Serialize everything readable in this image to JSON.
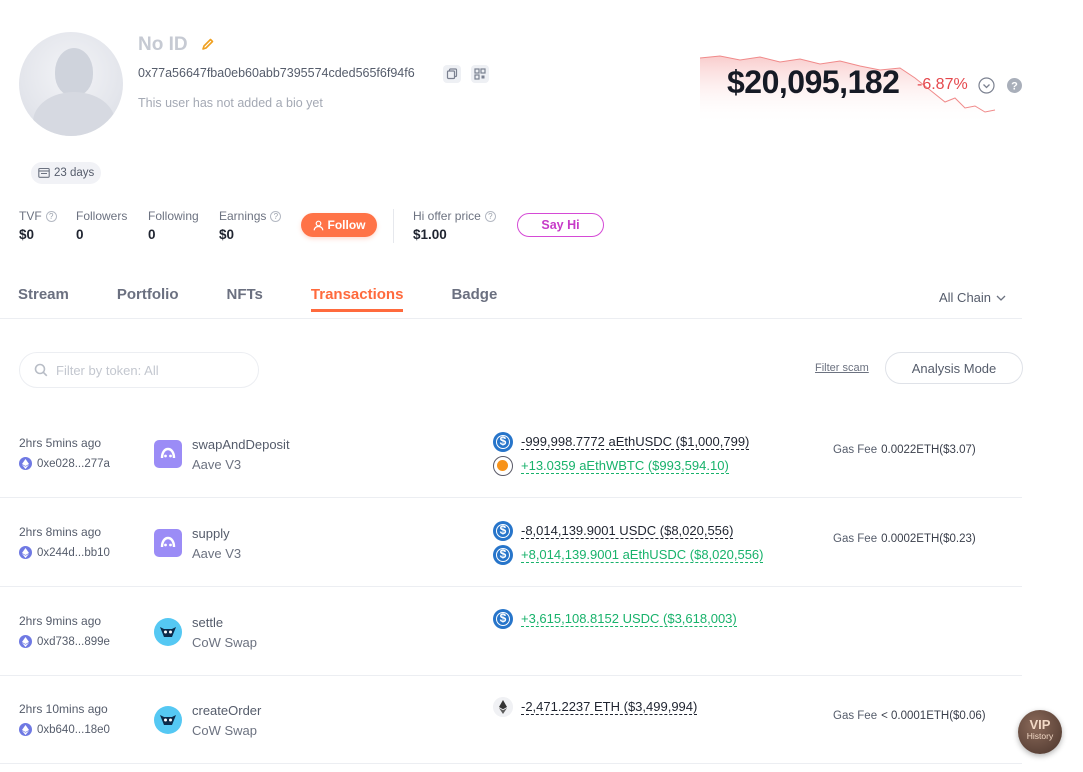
{
  "profile": {
    "name": "No ID",
    "address": "0x77a56647fba0eb60abb7395574cded565f6f94f6",
    "bio": "This user has not added a bio yet",
    "days_badge": "23 days"
  },
  "net_worth": {
    "value": "$20,095,182",
    "change": "-6.87%",
    "change_color": "#e5484d"
  },
  "stats": {
    "tvf_label": "TVF",
    "tvf_value": "$0",
    "followers_label": "Followers",
    "followers_value": "0",
    "following_label": "Following",
    "following_value": "0",
    "earnings_label": "Earnings",
    "earnings_value": "$0",
    "follow_button": "Follow",
    "offer_label": "Hi offer price",
    "offer_value": "$1.00",
    "say_hi_button": "Say Hi"
  },
  "tabs": [
    "Stream",
    "Portfolio",
    "NFTs",
    "Transactions",
    "Badge"
  ],
  "active_tab": "Transactions",
  "chain_select": "All Chain",
  "filter": {
    "placeholder": "Filter by token: All",
    "filter_scam": "Filter scam",
    "analysis_mode": "Analysis Mode"
  },
  "gas_label": "Gas Fee",
  "transactions": [
    {
      "time": "2hrs 5mins ago",
      "hash": "0xe028...277a",
      "method": "swapAndDeposit",
      "protocol": "Aave V3",
      "protocol_icon": "aave-logo",
      "tokens": [
        {
          "icon": "usdc-icon",
          "text": "-999,998.7772 aEthUSDC ($1,000,799)",
          "direction": "out"
        },
        {
          "icon": "wbtc-icon",
          "text": "+13.0359 aEthWBTC ($993,594.10)",
          "direction": "in"
        }
      ],
      "gas": "0.0022ETH($3.07)"
    },
    {
      "time": "2hrs 8mins ago",
      "hash": "0x244d...bb10",
      "method": "supply",
      "protocol": "Aave V3",
      "protocol_icon": "aave-logo",
      "tokens": [
        {
          "icon": "usdc-icon",
          "text": "-8,014,139.9001 USDC ($8,020,556)",
          "direction": "out"
        },
        {
          "icon": "usdc-icon",
          "text": "+8,014,139.9001 aEthUSDC ($8,020,556)",
          "direction": "in"
        }
      ],
      "gas": "0.0002ETH($0.23)"
    },
    {
      "time": "2hrs 9mins ago",
      "hash": "0xd738...899e",
      "method": "settle",
      "protocol": "CoW Swap",
      "protocol_icon": "cow-logo",
      "tokens": [
        {
          "icon": "usdc-icon",
          "text": "+3,615,108.8152 USDC ($3,618,003)",
          "direction": "in"
        }
      ],
      "gas": ""
    },
    {
      "time": "2hrs 10mins ago",
      "hash": "0xb640...18e0",
      "method": "createOrder",
      "protocol": "CoW Swap",
      "protocol_icon": "cow-logo",
      "tokens": [
        {
          "icon": "eth-icon",
          "text": "-2,471.2237 ETH ($3,499,994)",
          "direction": "out"
        }
      ],
      "gas": "< 0.0001ETH($0.06)"
    }
  ],
  "vip": {
    "title": "VIP",
    "subtitle": "History"
  }
}
